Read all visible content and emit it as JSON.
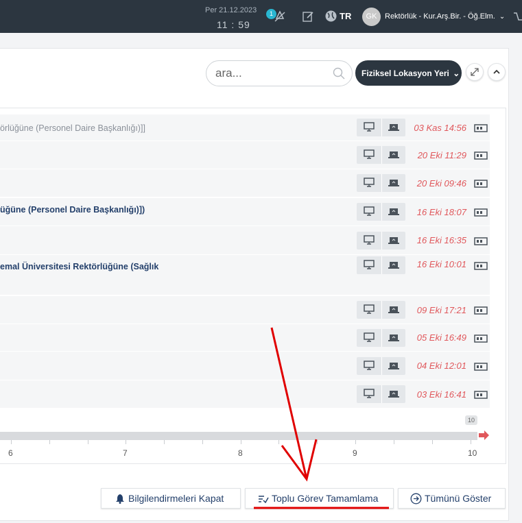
{
  "topbar": {
    "date": "Per 21.12.2023",
    "time": "11 : 59",
    "notif_count": "1",
    "lang": "TR",
    "avatar_initials": "GK",
    "user_label": "Rektörlük - Kur.Arş.Bir. - Öğ.Elm."
  },
  "toolbar": {
    "search_placeholder": "ara...",
    "location_button": "Fiziksel Lokasyon Yeri"
  },
  "rows": [
    {
      "title": "örlüğüne (Personel Daire Başkanlığı)]]",
      "style": "gray",
      "date": "03 Kas 14:56"
    },
    {
      "title": "",
      "style": "blue",
      "date": "20 Eki 11:29"
    },
    {
      "title": "",
      "style": "blue",
      "date": "20 Eki 09:46"
    },
    {
      "title": "üğüne (Personel Daire Başkanlığı)])",
      "style": "blue",
      "date": "16 Eki 18:07"
    },
    {
      "title": "",
      "style": "blue",
      "date": "16 Eki 16:35"
    },
    {
      "title": "emal Üniversitesi Rektörlüğüne (Sağlık",
      "style": "blue",
      "date": "16 Eki 10:01"
    },
    {
      "title": "",
      "style": "blue",
      "date": "09 Eki 17:21"
    },
    {
      "title": "",
      "style": "blue",
      "date": "05 Eki 16:49"
    },
    {
      "title": "",
      "style": "blue",
      "date": "04 Eki 12:01"
    },
    {
      "title": "",
      "style": "blue",
      "date": "03 Eki 16:41"
    }
  ],
  "timeline": {
    "badge": "10",
    "tick_labels": [
      "6",
      "7",
      "8",
      "9",
      "10"
    ]
  },
  "footer": {
    "notifications_close": "Bilgilendirmeleri Kapat",
    "bulk_complete": "Toplu Görev Tamamlama",
    "show_all": "Tümünü Göster"
  },
  "colors": {
    "topbar": "#2c3640",
    "date_red": "#e0575b",
    "link_blue": "#24406b",
    "annotation_red": "#e00000"
  }
}
